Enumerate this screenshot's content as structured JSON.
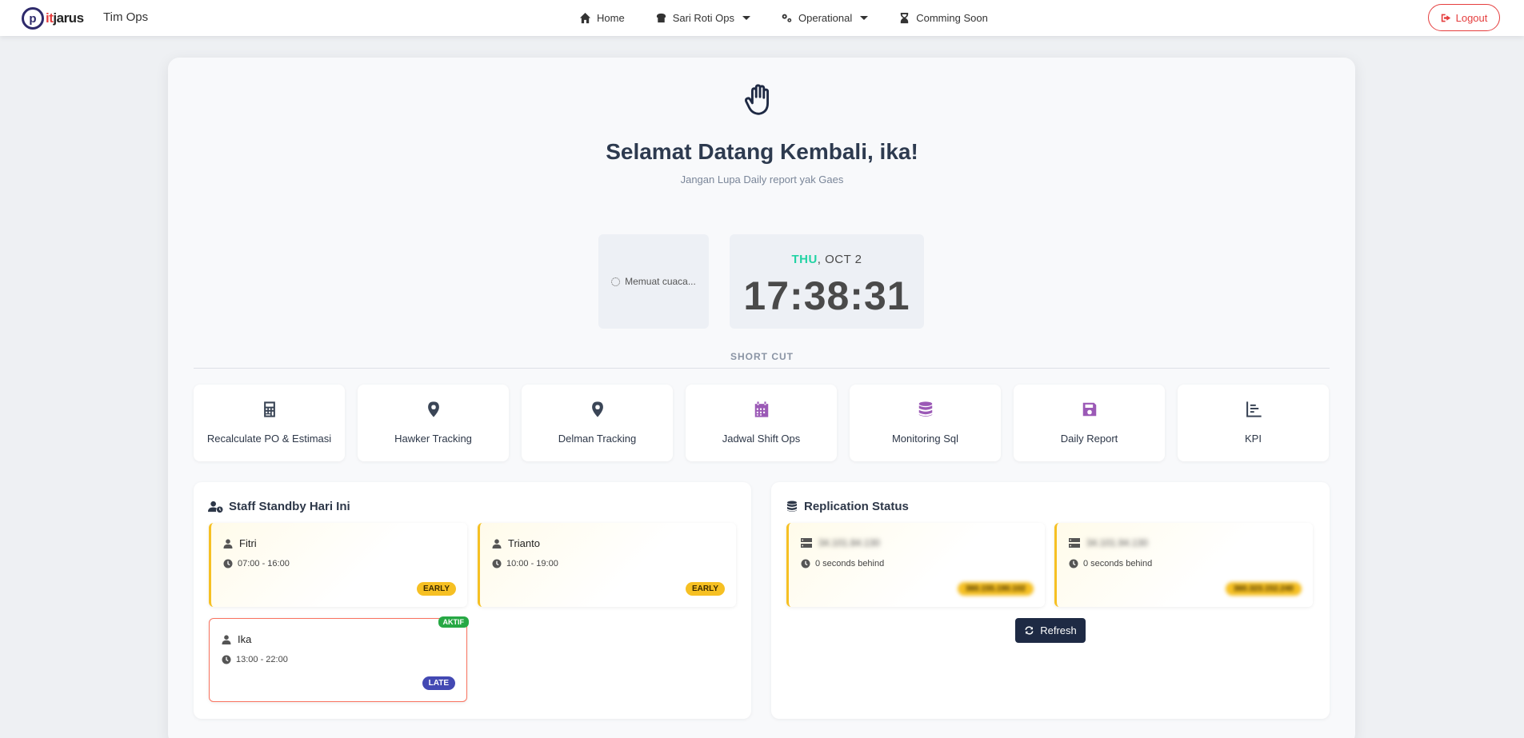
{
  "nav": {
    "brand_prefix": "p",
    "brand_it": "it",
    "brand_rest": "jarus",
    "team": "Tim Ops",
    "home": "Home",
    "sari_roti": "Sari Roti Ops",
    "operational": "Operational",
    "coming_soon": "Comming Soon",
    "logout": "Logout"
  },
  "hero": {
    "welcome": "Selamat Datang Kembali, ika!",
    "subtitle": "Jangan Lupa Daily report yak Gaes"
  },
  "weather": {
    "loading": "Memuat cuaca..."
  },
  "clock": {
    "day": "THU",
    "date": ", OCT 2",
    "time": "17:38:31"
  },
  "shortcut": {
    "title": "SHORT CUT",
    "items": [
      {
        "label": "Recalculate PO & Estimasi",
        "icon": "calculator-icon",
        "color": "#3a4556"
      },
      {
        "label": "Hawker Tracking",
        "icon": "map-pin-icon",
        "color": "#3a4556"
      },
      {
        "label": "Delman Tracking",
        "icon": "map-pin-icon",
        "color": "#3a4556"
      },
      {
        "label": "Jadwal Shift Ops",
        "icon": "calendar-icon",
        "color": "#9b59b6"
      },
      {
        "label": "Monitoring Sql",
        "icon": "database-icon",
        "color": "#9b59b6"
      },
      {
        "label": "Daily Report",
        "icon": "save-icon",
        "color": "#9b59b6"
      },
      {
        "label": "KPI",
        "icon": "bar-chart-icon",
        "color": "#3a4556"
      }
    ]
  },
  "staff": {
    "title": "Staff Standby Hari Ini",
    "items": [
      {
        "name": "Fitri",
        "time": "07:00 - 16:00",
        "badge": "EARLY"
      },
      {
        "name": "Trianto",
        "time": "10:00 - 19:00",
        "badge": "EARLY"
      },
      {
        "name": "Ika",
        "time": "13:00 - 22:00",
        "badge": "LATE",
        "status": "AKTIF"
      }
    ]
  },
  "replication": {
    "title": "Replication Status",
    "items": [
      {
        "host": "34.101.84.130",
        "behind": "0 seconds behind",
        "ip": "360.155.190.102"
      },
      {
        "host": "34.101.94.130",
        "behind": "0 seconds behind",
        "ip": "360.323.152.240"
      }
    ],
    "refresh": "Refresh"
  },
  "colors": {
    "accent_dark": "#1e2a44",
    "early": "#f6c023",
    "late": "#4349b3",
    "active": "#27a844",
    "logout": "#e53e3e",
    "day": "#22d3a4"
  }
}
